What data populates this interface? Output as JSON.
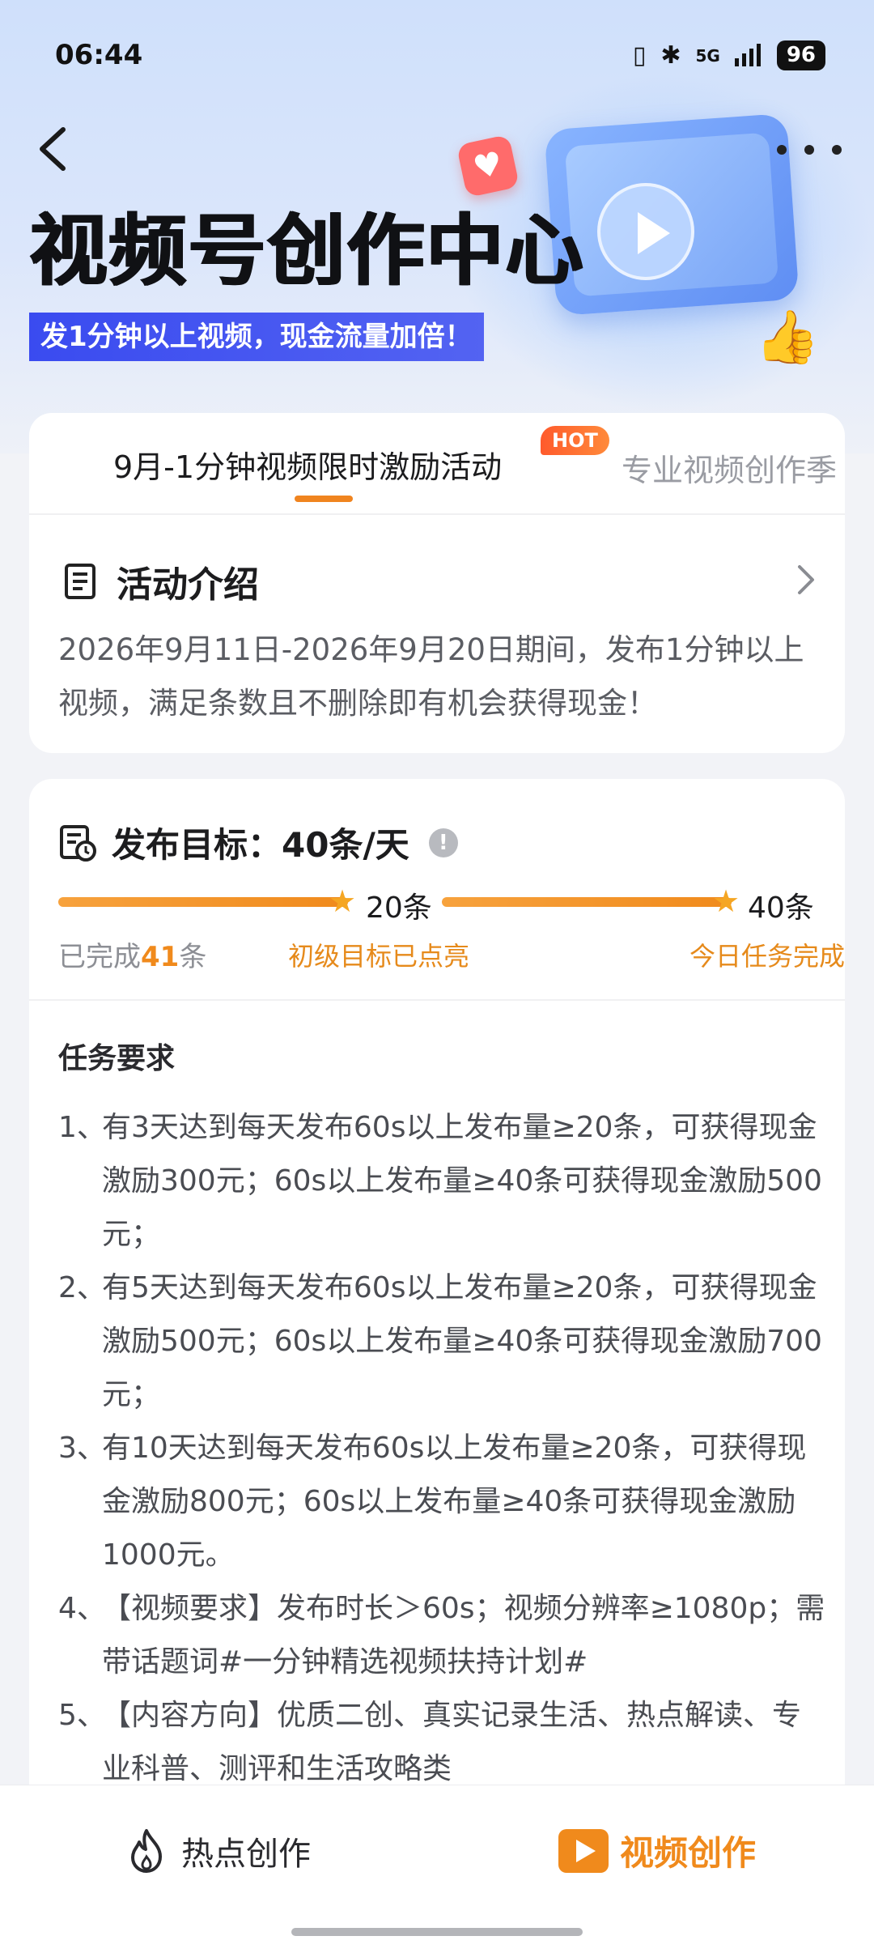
{
  "status_bar": {
    "time": "06:44",
    "network": "5G",
    "battery": "96"
  },
  "hero": {
    "title": "视频号创作中心",
    "banner": "发1分钟以上视频，现金流量加倍！"
  },
  "tabs": {
    "active": "9月-1分钟视频限时激励活动",
    "hot_badge": "HOT",
    "inactive": "专业视频创作季"
  },
  "intro": {
    "title": "活动介绍",
    "text": "2026年9月11日-2026年9月20日期间，发布1分钟以上视频，满足条数且不删除即有机会获得现金！"
  },
  "goal": {
    "title": "发布目标：40条/天",
    "info_icon": "!",
    "milestone_1": "20条",
    "milestone_2": "40条",
    "done_prefix": "已完成",
    "done_count": "41",
    "done_suffix": "条",
    "tier_1_status": "初级目标已点亮",
    "tier_2_status": "今日任务完成",
    "progress": 1.0
  },
  "requirements": {
    "title": "任务要求",
    "items": [
      {
        "num": "1、",
        "text": "有3天达到每天发布60s以上发布量≥20条，可获得现金激励300元；60s以上发布量≥40条可获得现金激励500元；"
      },
      {
        "num": "2、",
        "text": "有5天达到每天发布60s以上发布量≥20条，可获得现金激励500元；60s以上发布量≥40条可获得现金激励700元；"
      },
      {
        "num": "3、",
        "text": "有10天达到每天发布60s以上发布量≥20条，可获得现金激励800元；60s以上发布量≥40条可获得现金激励1000元。"
      },
      {
        "num": "4、",
        "text": "【视频要求】发布时长＞60s；视频分辨率≥1080p；需带话题词#一分钟精选视频扶持计划#"
      },
      {
        "num": "5、",
        "text": "【内容方向】优质二创、真实记录生活、热点解读、专业科普、测评和生活攻略类"
      }
    ]
  },
  "bottom_nav": {
    "hot_label": "热点创作",
    "video_label": "视频创作"
  },
  "colors": {
    "accent": "#f08a1c",
    "banner": "#3a4bf0",
    "hot_badge": "#ff5a2c"
  },
  "icons": [
    "back-icon",
    "more-icon",
    "document-icon",
    "chevron-right-icon",
    "calendar-clock-icon",
    "info-icon",
    "star-icon",
    "flame-icon",
    "video-play-icon"
  ]
}
